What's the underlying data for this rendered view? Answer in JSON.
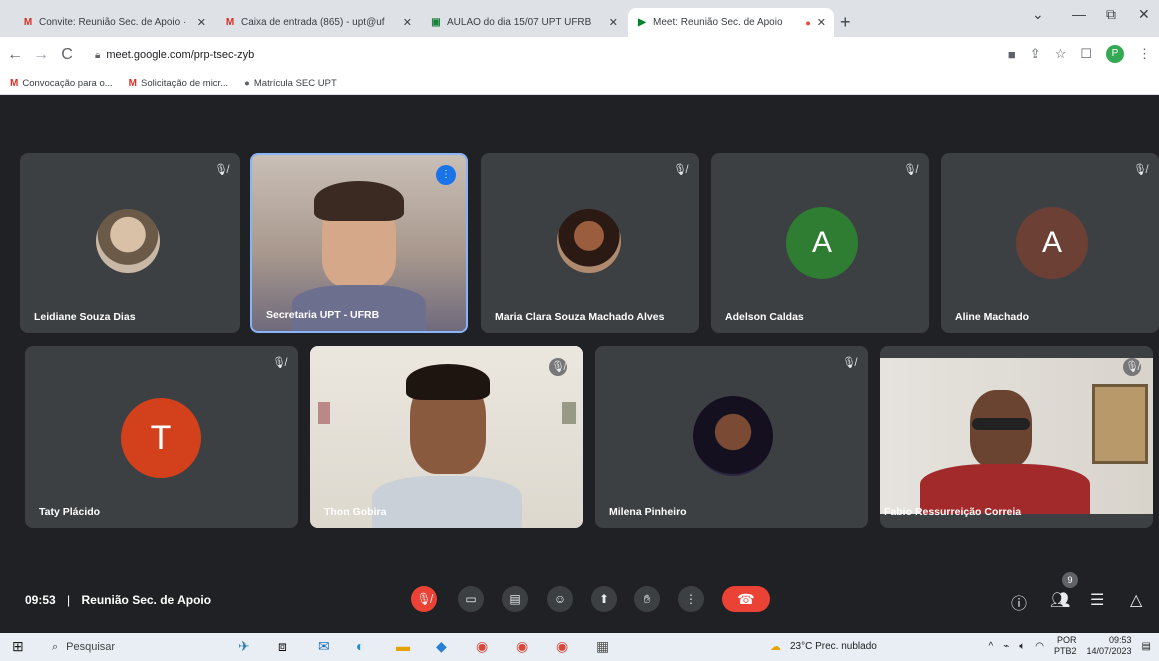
{
  "browser": {
    "tabs": [
      {
        "label": "Convite: Reunião Sec. de Apoio ·",
        "icon": "M",
        "icon_color": "#d93025"
      },
      {
        "label": "Caixa de entrada (865) - upt@uf",
        "icon": "M",
        "icon_color": "#d93025"
      },
      {
        "label": "AULÃO do dia 15/07 UPT UFRB",
        "icon": "▣",
        "icon_color": "#188038"
      },
      {
        "label": "Meet: Reunião Sec. de Apoio",
        "icon": "▶",
        "icon_color": "#00832d",
        "active": true
      }
    ],
    "new_tab": "+",
    "url": "meet.google.com/prp-tsec-zyb",
    "profile_initial": "P",
    "bookmarks": [
      {
        "label": "Convocação para o...",
        "icon": "M"
      },
      {
        "label": "Solicitação de micr...",
        "icon": "M"
      },
      {
        "label": "Matrícula SEC UPT",
        "icon": "●"
      }
    ]
  },
  "meet": {
    "participants": [
      {
        "name": "Leidiane Souza Dias",
        "type": "photo",
        "muted": true
      },
      {
        "name": "Secretaria UPT - UFRB",
        "type": "video",
        "speaking": true
      },
      {
        "name": "Maria Clara Souza Machado Alves",
        "type": "photo",
        "muted": true
      },
      {
        "name": "Adelson Caldas",
        "type": "letter",
        "letter": "A",
        "color": "#2e7d32",
        "muted": true
      },
      {
        "name": "Aline Machado",
        "type": "letter",
        "letter": "A",
        "color": "#6d4036",
        "muted": true
      },
      {
        "name": "Taty Plácido",
        "type": "letter",
        "letter": "T",
        "color": "#d3401c",
        "muted": true
      },
      {
        "name": "Thon Gobira",
        "type": "video",
        "muted": true
      },
      {
        "name": "Milena Pinheiro",
        "type": "photo",
        "muted": true
      },
      {
        "name": "Fabio Ressurreição Correia",
        "type": "video",
        "muted": true
      }
    ],
    "time": "09:53",
    "separator": "|",
    "meeting_title": "Reunião Sec. de Apoio",
    "participant_count": "9"
  },
  "taskbar": {
    "search_placeholder": "Pesquisar",
    "weather": "23°C Prec. nublado",
    "lang_top": "POR",
    "lang_bottom": "PTB2",
    "clock_time": "09:53",
    "clock_date": "14/07/2023"
  },
  "colors": {
    "meet_bg": "#202124",
    "tile_bg": "#3c4043",
    "accent": "#1a73e8",
    "red": "#ea4335"
  }
}
